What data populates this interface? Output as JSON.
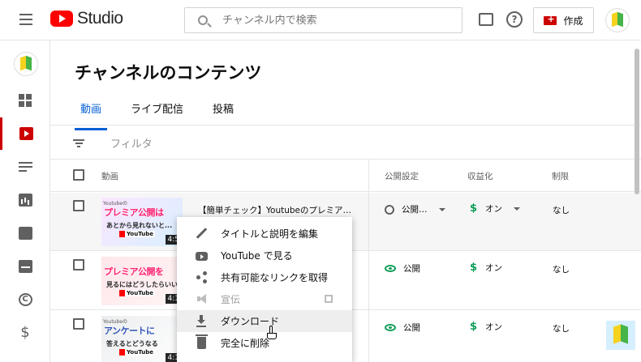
{
  "header": {
    "logo_text": "Studio",
    "search_placeholder": "チャンネル内で検索",
    "create_label": "作成"
  },
  "sidebar": {
    "items": [
      {
        "name": "dashboard"
      },
      {
        "name": "content",
        "active": true
      },
      {
        "name": "playlists"
      },
      {
        "name": "analytics"
      },
      {
        "name": "comments"
      },
      {
        "name": "subtitles"
      },
      {
        "name": "copyright"
      },
      {
        "name": "monetization"
      }
    ]
  },
  "page": {
    "title": "チャンネルのコンテンツ",
    "tabs": [
      "動画",
      "ライブ配信",
      "投稿"
    ],
    "active_tab": 0,
    "filter_placeholder": "フィルタ"
  },
  "table": {
    "columns": {
      "video": "動画",
      "visibility": "公開設定",
      "monetization": "収益化",
      "restrictions": "制限"
    },
    "rows": [
      {
        "title": "【簡単チェック】Youtubeのプレミア…",
        "thumb_tag": "Youtubeの",
        "thumb_line1": "プレミア公開は",
        "thumb_line2": "あとから見れないと...",
        "thumb_brand": "YouTube",
        "duration": "4:5",
        "visibility": "公開…",
        "visibility_icon": "clock-icon",
        "monetization": "オン",
        "restriction": "なし"
      },
      {
        "title": "",
        "thumb_tag": "",
        "thumb_line1": "プレミア公開を",
        "thumb_line2": "見るにはどうしたらいい",
        "thumb_brand": "YouTube",
        "duration": "4:1",
        "visibility": "公開",
        "visibility_icon": "eye-icon",
        "monetization": "オン",
        "restriction": "なし"
      },
      {
        "title": "",
        "thumb_tag": "Youtubeの",
        "thumb_line1": "アンケートに",
        "thumb_line2": "答えるとどうなる",
        "thumb_brand": "YouTube",
        "duration": "4:1",
        "visibility": "公開",
        "visibility_icon": "eye-icon",
        "monetization": "オン",
        "restriction": "なし"
      }
    ]
  },
  "context_menu": {
    "items": [
      {
        "label": "タイトルと説明を編集",
        "icon": "pencil-icon"
      },
      {
        "label": "YouTube で見る",
        "icon": "youtube-icon"
      },
      {
        "label": "共有可能なリンクを取得",
        "icon": "share-icon"
      },
      {
        "label": "宣伝",
        "icon": "megaphone-icon",
        "disabled": true
      },
      {
        "label": "ダウンロード",
        "icon": "download-icon",
        "highlighted": true
      },
      {
        "label": "完全に削除",
        "icon": "trash-icon"
      }
    ]
  },
  "colors": {
    "accent_blue": "#065fd4",
    "brand_red": "#ff0000",
    "status_green": "#0f9d58"
  }
}
